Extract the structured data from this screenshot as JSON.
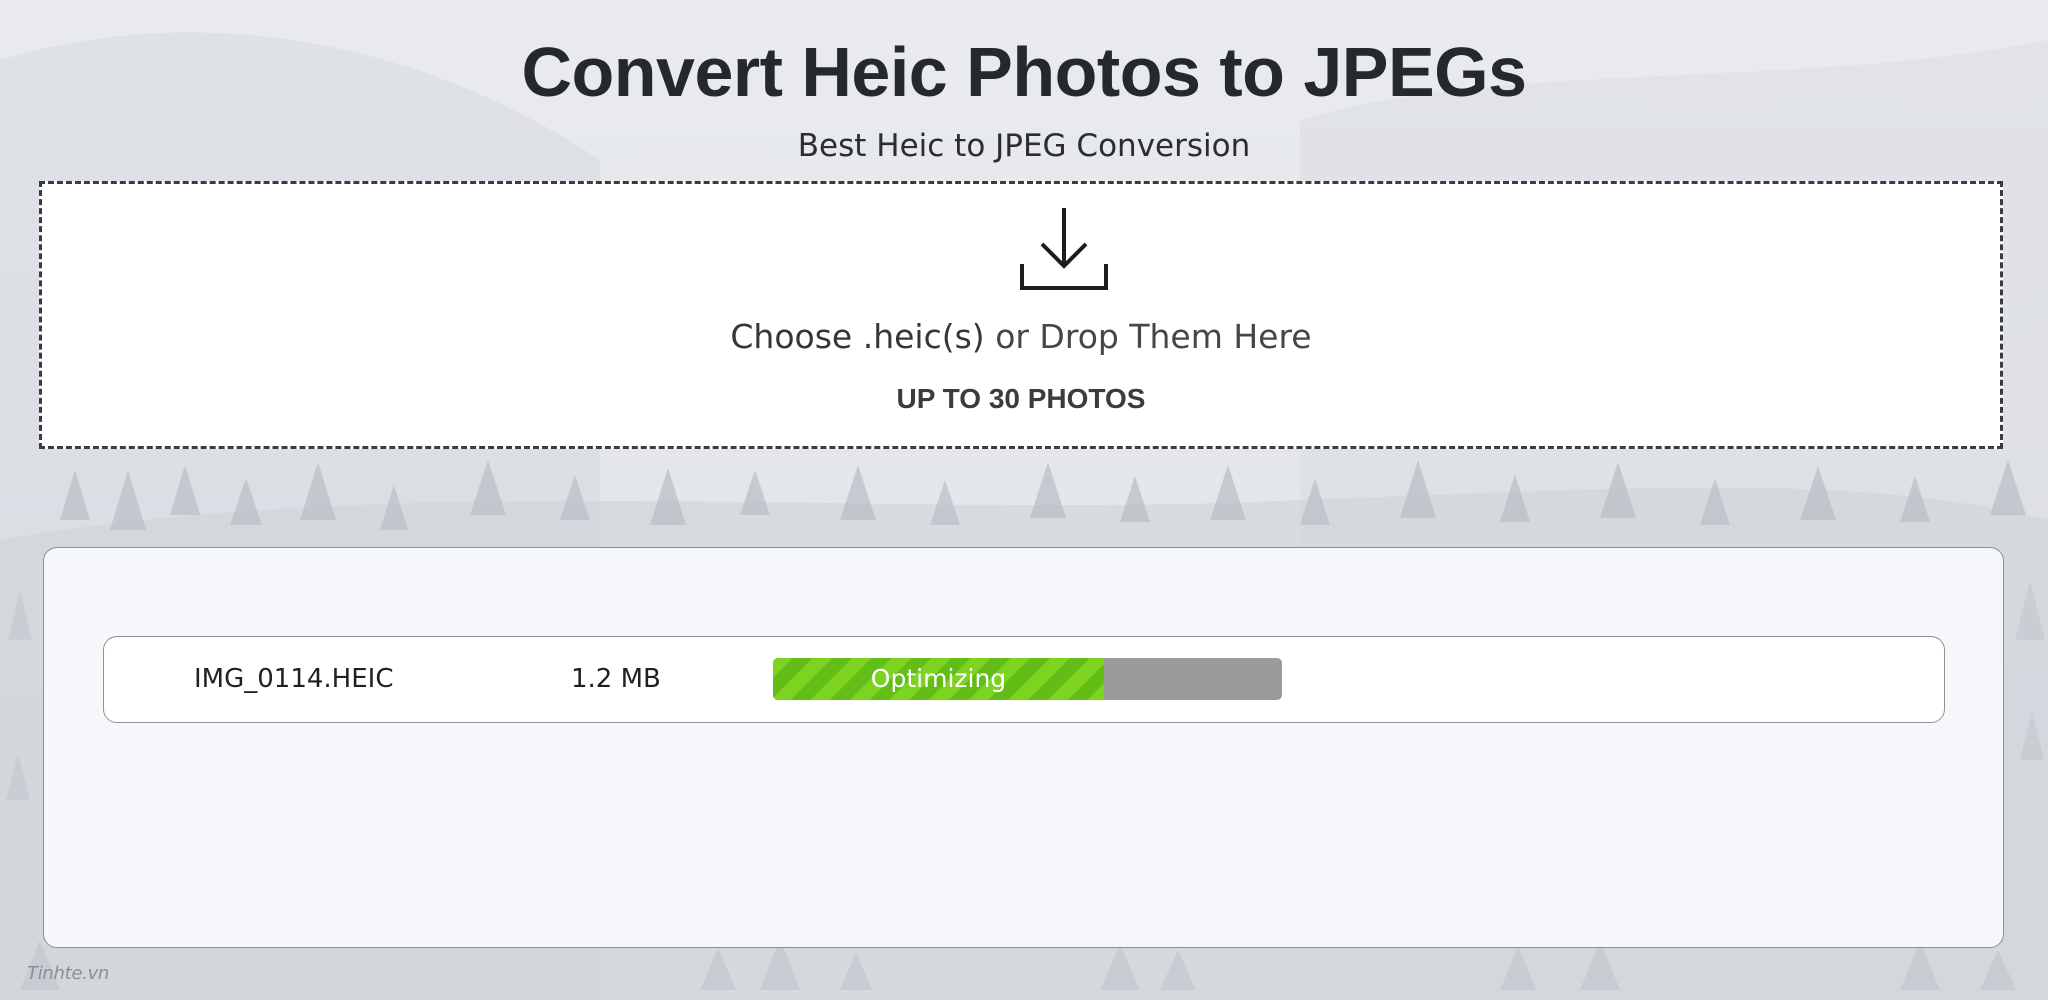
{
  "header": {
    "title": "Convert Heic Photos to JPEGs",
    "subtitle": "Best Heic to JPEG Conversion"
  },
  "dropzone": {
    "icon": "download-icon",
    "choose_label": "Choose .heic(s)",
    "drop_label": "or Drop Them Here",
    "limit_label": "UP TO 30 PHOTOS"
  },
  "files": [
    {
      "name": "IMG_0114.HEIC",
      "size": "1.2 MB",
      "status": "Optimizing",
      "progress": 0.65
    }
  ],
  "colors": {
    "progress_fill": "#7ed321",
    "progress_track": "#9b9b9b",
    "title_text": "#25282c"
  },
  "watermark": "Tinhte.vn"
}
